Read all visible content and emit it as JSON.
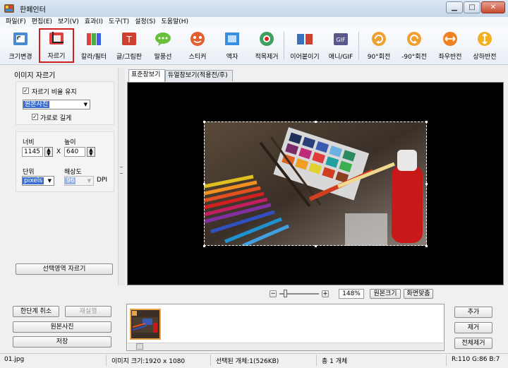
{
  "window": {
    "title": "한페인터",
    "minimize": "▁",
    "maximize": "□",
    "close": "✕"
  },
  "menu": [
    "파일(F)",
    "편집(E)",
    "보기(V)",
    "효과(I)",
    "도구(T)",
    "설정(S)",
    "도움말(H)"
  ],
  "toolbar": [
    {
      "label": "크기변경",
      "icon": "resize-icon"
    },
    {
      "label": "자르기",
      "icon": "crop-icon",
      "selected": true
    },
    {
      "label": "칼라/필터",
      "icon": "color-filter-icon"
    },
    {
      "label": "글/그림판",
      "icon": "text-board-icon"
    },
    {
      "label": "말풍선",
      "icon": "speech-bubble-icon"
    },
    {
      "label": "스티커",
      "icon": "sticker-icon"
    },
    {
      "label": "액자",
      "icon": "frame-icon"
    },
    {
      "label": "적목제거",
      "icon": "red-eye-icon"
    },
    {
      "label": "이어붙이기",
      "icon": "join-icon"
    },
    {
      "label": "애니/GIF",
      "icon": "gif-icon"
    },
    {
      "label": "90°회전",
      "icon": "rotate-cw-icon"
    },
    {
      "label": "-90°회전",
      "icon": "rotate-ccw-icon"
    },
    {
      "label": "좌우반전",
      "icon": "flip-h-icon"
    },
    {
      "label": "상하반전",
      "icon": "flip-v-icon"
    }
  ],
  "crop_panel": {
    "title": "이미지 자르기",
    "keep_ratio": "자르기 비율 유지",
    "ratio_select": "원본사진",
    "landscape": "가로로 길게",
    "width_label": "너비",
    "height_label": "높이",
    "width": "1145",
    "height": "640",
    "x_sep": "X",
    "unit_label": "단위",
    "unit": "pixels",
    "resolution_label": "해상도",
    "resolution": "96",
    "dpi": "DPI",
    "crop_button": "선택영역 자르기"
  },
  "actions": {
    "undo": "한단계 취소",
    "redo": "재실행",
    "original": "원본사진",
    "save": "저장"
  },
  "viewer": {
    "tab_standard": "표준창보기",
    "tab_dual": "듀얼창보기(적용전/후)",
    "zoom": "148%",
    "zoom_minus": "−",
    "zoom_plus": "+",
    "original_size": "원본크기",
    "fit_screen": "화면맞춤"
  },
  "thumbs": {
    "add": "추가",
    "remove": "제거",
    "remove_all": "전체제거"
  },
  "status": {
    "file": "01.jpg",
    "image_size": "이미지 크기:1920 x 1080",
    "selected": "선택된 개체:1(526KB)",
    "total": "총 1 개체",
    "rgb": "R:110 G:86 B:7"
  },
  "colors": {
    "accent": "#3a6ed0",
    "selected_border": "#d02020",
    "canvas": "#000000"
  }
}
